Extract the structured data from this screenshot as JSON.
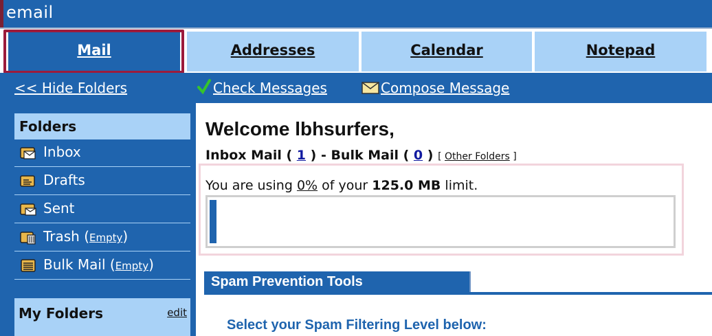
{
  "window": {
    "title": "email"
  },
  "tabs": [
    {
      "label": "Mail",
      "active": true
    },
    {
      "label": "Addresses",
      "active": false
    },
    {
      "label": "Calendar",
      "active": false
    },
    {
      "label": "Notepad",
      "active": false
    }
  ],
  "toolbar": {
    "hide_folders": "<< Hide Folders",
    "check_messages": "Check Messages",
    "compose_message": "Compose Message"
  },
  "sidebar": {
    "folders_header": "Folders",
    "folders": [
      {
        "name": "Inbox",
        "icon": "inbox-icon",
        "empty_link": ""
      },
      {
        "name": "Drafts",
        "icon": "drafts-icon",
        "empty_link": ""
      },
      {
        "name": "Sent",
        "icon": "sent-icon",
        "empty_link": ""
      },
      {
        "name": "Trash",
        "icon": "trash-icon",
        "empty_link": "Empty"
      },
      {
        "name": "Bulk Mail",
        "icon": "bulk-mail-icon",
        "empty_link": "Empty"
      }
    ],
    "my_folders_label": "My Folders",
    "my_folders_edit": "edit"
  },
  "main": {
    "welcome": "Welcome lbhsurfers,",
    "inbox_label": "Inbox Mail (",
    "inbox_count": "1",
    "bulk_label": ") - Bulk Mail (",
    "bulk_count": "0",
    "close_paren": ")",
    "other_folders_open": "[",
    "other_folders": "Other Folders",
    "other_folders_close": "]",
    "usage_prefix": "You are using",
    "usage_percent": "0%",
    "usage_mid": "of your",
    "usage_limit": "125.0 MB",
    "usage_suffix": "limit.",
    "usage_fraction": 0.0,
    "spam_tab": "Spam Prevention Tools",
    "spam_select": "Select your Spam Filtering Level below:"
  },
  "colors": {
    "primary_blue": "#1f64ae",
    "light_blue": "#a9d2f7",
    "highlight_red": "#9c1b3c"
  }
}
